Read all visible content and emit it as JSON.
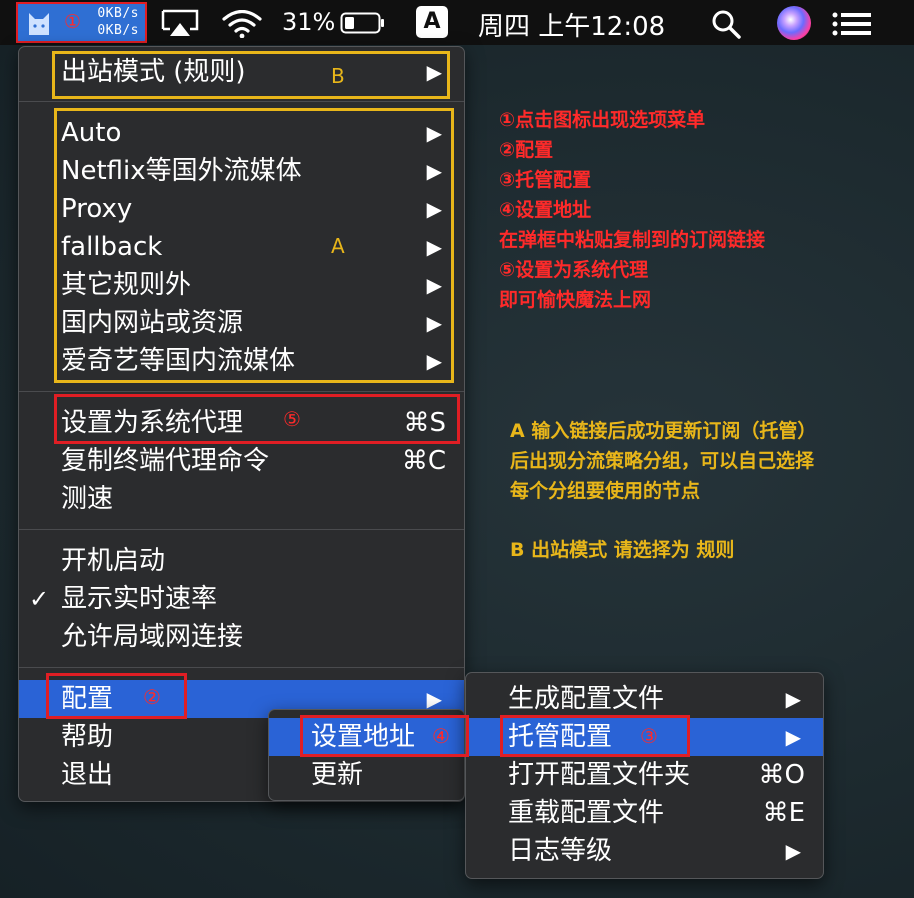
{
  "menubar": {
    "speed_up": "0KB/s",
    "speed_down": "0KB/s",
    "marker": "①",
    "battery_percent": "31%",
    "input_source": "A",
    "clock": "周四 上午12:08",
    "icons": [
      "clash-cat-icon",
      "airplay-icon",
      "wifi-icon",
      "battery-icon",
      "input-source-icon",
      "spotlight-icon",
      "siri-icon",
      "notification-center-icon"
    ]
  },
  "main_menu": {
    "outbound_mode": "出站模式 (规则)",
    "proxy_groups": [
      "Auto",
      "Netflix等国外流媒体",
      "Proxy",
      "fallback",
      "其它规则外",
      "国内网站或资源",
      "爱奇艺等国内流媒体"
    ],
    "set_system_proxy": "设置为系统代理",
    "set_system_proxy_shortcut": "⌘S",
    "copy_terminal_cmd": "复制终端代理命令",
    "copy_terminal_cmd_shortcut": "⌘C",
    "speed_test": "测速",
    "launch_at_login": "开机启动",
    "show_speed": "显示实时速率",
    "show_speed_checked": "✓",
    "allow_lan": "允许局域网连接",
    "config": "配置",
    "help": "帮助",
    "quit": "退出"
  },
  "config_menu": {
    "generate": "生成配置文件",
    "managed": "托管配置",
    "open_folder": "打开配置文件夹",
    "open_folder_shortcut": "⌘O",
    "reload": "重载配置文件",
    "reload_shortcut": "⌘E",
    "log_level": "日志等级"
  },
  "managed_menu": {
    "set_url": "设置地址",
    "update": "更新"
  },
  "markers": {
    "m2": "②",
    "m3": "③",
    "m4": "④",
    "m5": "⑤",
    "A": "A",
    "B": "B"
  },
  "annotations": {
    "steps": [
      "①点击图标出现选项菜单",
      "②配置",
      "③托管配置",
      "④设置地址",
      "在弹框中粘贴复制到的订阅链接",
      "⑤设置为系统代理",
      "即可愉快魔法上网"
    ],
    "note_a": [
      "A 输入链接后成功更新订阅（托管）",
      "后出现分流策略分组，可以自己选择",
      "每个分组要使用的节点"
    ],
    "note_b": "B 出站模式 请选择为 规则"
  },
  "colors": {
    "highlight": "#2a63d6",
    "annotation_red": "#ff2a2a",
    "annotation_yellow": "#e8b61a"
  }
}
